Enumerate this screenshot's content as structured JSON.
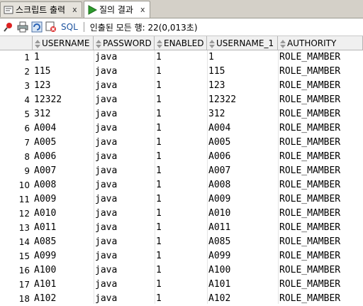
{
  "tabs": [
    {
      "label": "스크립트 출력",
      "icon": "script-output-icon",
      "close": "x"
    },
    {
      "label": "질의 결과",
      "icon": "run-query-icon",
      "close": "x"
    }
  ],
  "toolbar": {
    "icons": [
      "pin-icon",
      "print-icon",
      "refresh-icon",
      "cancel-query-icon"
    ],
    "sql_label": "SQL",
    "status": "인출된 모든 행: 22(0,013초)"
  },
  "columns": [
    "USERNAME",
    "PASSWORD",
    "ENABLED",
    "USERNAME_1",
    "AUTHORITY"
  ],
  "rows": [
    [
      "1",
      "1",
      "java",
      "1",
      "1",
      "ROLE_MAMBER"
    ],
    [
      "2",
      "115",
      "java",
      "1",
      "115",
      "ROLE_MAMBER"
    ],
    [
      "3",
      "123",
      "java",
      "1",
      "123",
      "ROLE_MAMBER"
    ],
    [
      "4",
      "12322",
      "java",
      "1",
      "12322",
      "ROLE_MAMBER"
    ],
    [
      "5",
      "312",
      "java",
      "1",
      "312",
      "ROLE_MAMBER"
    ],
    [
      "6",
      "A004",
      "java",
      "1",
      "A004",
      "ROLE_MAMBER"
    ],
    [
      "7",
      "A005",
      "java",
      "1",
      "A005",
      "ROLE_MAMBER"
    ],
    [
      "8",
      "A006",
      "java",
      "1",
      "A006",
      "ROLE_MAMBER"
    ],
    [
      "9",
      "A007",
      "java",
      "1",
      "A007",
      "ROLE_MAMBER"
    ],
    [
      "10",
      "A008",
      "java",
      "1",
      "A008",
      "ROLE_MAMBER"
    ],
    [
      "11",
      "A009",
      "java",
      "1",
      "A009",
      "ROLE_MAMBER"
    ],
    [
      "12",
      "A010",
      "java",
      "1",
      "A010",
      "ROLE_MAMBER"
    ],
    [
      "13",
      "A011",
      "java",
      "1",
      "A011",
      "ROLE_MAMBER"
    ],
    [
      "14",
      "A085",
      "java",
      "1",
      "A085",
      "ROLE_MAMBER"
    ],
    [
      "15",
      "A099",
      "java",
      "1",
      "A099",
      "ROLE_MAMBER"
    ],
    [
      "16",
      "A100",
      "java",
      "1",
      "A100",
      "ROLE_MAMBER"
    ],
    [
      "17",
      "A101",
      "java",
      "1",
      "A101",
      "ROLE_MAMBER"
    ],
    [
      "18",
      "A102",
      "java",
      "1",
      "A102",
      "ROLE_MAMBER"
    ]
  ]
}
